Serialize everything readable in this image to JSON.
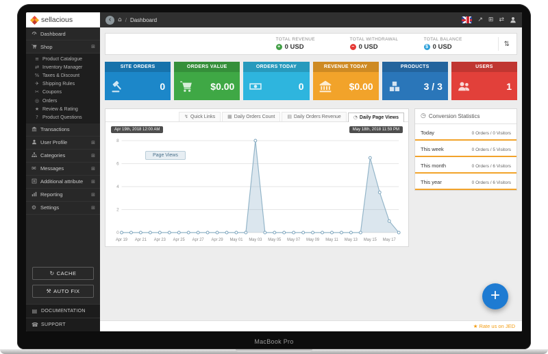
{
  "device": {
    "label": "MacBook Pro"
  },
  "sidebar": {
    "brand": "sellacious",
    "items": [
      {
        "label": "Dashboard",
        "icon": "dashboard",
        "expandable": false
      },
      {
        "label": "Shop",
        "icon": "shopping-cart",
        "expandable": true,
        "expanded": true,
        "children": [
          {
            "label": "Product Catalogue",
            "icon": "list"
          },
          {
            "label": "Inventory Manager",
            "icon": "exchange"
          },
          {
            "label": "Taxes & Discount",
            "icon": "percent"
          },
          {
            "label": "Shipping Rules",
            "icon": "plane"
          },
          {
            "label": "Coupons",
            "icon": "scissors"
          },
          {
            "label": "Orders",
            "icon": "orders"
          },
          {
            "label": "Review & Rating",
            "icon": "star"
          },
          {
            "label": "Product Questions",
            "icon": "question"
          }
        ]
      },
      {
        "label": "Transactions",
        "icon": "bank-building",
        "expandable": false
      },
      {
        "label": "User Profile",
        "icon": "user",
        "expandable": true
      },
      {
        "label": "Categories",
        "icon": "sitemap",
        "expandable": true
      },
      {
        "label": "Messages",
        "icon": "envelope",
        "expandable": true
      },
      {
        "label": "Additional attribute",
        "icon": "attribute",
        "expandable": true
      },
      {
        "label": "Reporting",
        "icon": "report",
        "expandable": true
      },
      {
        "label": "Settings",
        "icon": "gear",
        "expandable": true
      }
    ],
    "actions": [
      {
        "label": "CACHE",
        "icon": "refresh"
      },
      {
        "label": "AUTO FIX",
        "icon": "wrench"
      }
    ],
    "footer_items": [
      {
        "label": "DOCUMENTATION",
        "icon": "book"
      },
      {
        "label": "SUPPORT",
        "icon": "support"
      }
    ]
  },
  "topbar": {
    "breadcrumb": "Dashboard"
  },
  "totals": [
    {
      "label": "TOTAL REVENUE",
      "value": "0 USD",
      "icon": "plus-circle",
      "color": "#43a047"
    },
    {
      "label": "TOTAL WITHDRAWAL",
      "value": "0 USD",
      "icon": "minus-circle",
      "color": "#e53935"
    },
    {
      "label": "TOTAL BALANCE",
      "value": "0 USD",
      "icon": "balance-circle",
      "color": "#2b9fd8"
    }
  ],
  "tiles": [
    {
      "label": "SITE ORDERS",
      "value": "0",
      "icon": "gavel",
      "color": "#1c87c9"
    },
    {
      "label": "ORDERS VALUE",
      "value": "$0.00",
      "icon": "shopping-cart-big",
      "color": "#3fa845"
    },
    {
      "label": "ORDERS TODAY",
      "value": "0",
      "icon": "banknote",
      "color": "#2eb5de"
    },
    {
      "label": "REVENUE TODAY",
      "value": "$0.00",
      "icon": "bank-big",
      "color": "#f2a32a"
    },
    {
      "label": "PRODUCTS",
      "value": "3 / 3",
      "icon": "cubes",
      "color": "#2a76b9"
    },
    {
      "label": "USERS",
      "value": "1",
      "icon": "user-group",
      "color": "#e2403a"
    }
  ],
  "chart_panel": {
    "tabs": [
      {
        "label": "Quick Links",
        "icon": "quick-links",
        "active": false
      },
      {
        "label": "Daily Orders Count",
        "icon": "calendar",
        "active": false
      },
      {
        "label": "Daily Orders Revenue",
        "icon": "revenue",
        "active": false
      },
      {
        "label": "Daily Page Views",
        "icon": "eye",
        "active": true
      }
    ],
    "range_start": "Apr 19th, 2018 12:00 AM",
    "range_end": "May 18th, 2018 11:59 PM",
    "legend": "Page Views"
  },
  "chart_data": {
    "type": "area",
    "title": "Daily Page Views",
    "series_name": "Page Views",
    "x": [
      "Apr 19",
      "Apr 20",
      "Apr 21",
      "Apr 22",
      "Apr 23",
      "Apr 24",
      "Apr 25",
      "Apr 26",
      "Apr 27",
      "Apr 28",
      "Apr 29",
      "Apr 30",
      "May 01",
      "May 02",
      "May 03",
      "May 04",
      "May 05",
      "May 06",
      "May 07",
      "May 08",
      "May 09",
      "May 10",
      "May 11",
      "May 12",
      "May 13",
      "May 14",
      "May 15",
      "May 16",
      "May 17",
      "May 18"
    ],
    "values": [
      0,
      0,
      0,
      0,
      0,
      0,
      0,
      0,
      0,
      0,
      0,
      0,
      0,
      0,
      8,
      0,
      0,
      0,
      0,
      0,
      0,
      0,
      0,
      0,
      0,
      0,
      6.5,
      3.5,
      1,
      0
    ],
    "tick_labels": [
      "Apr 19",
      "Apr 21",
      "Apr 23",
      "Apr 25",
      "Apr 27",
      "Apr 29",
      "May 01",
      "May 03",
      "May 05",
      "May 07",
      "May 09",
      "May 11",
      "May 13",
      "May 15",
      "May 17"
    ],
    "yticks": [
      0,
      2,
      4,
      6,
      8
    ],
    "ylim": [
      0,
      8
    ],
    "grid": true,
    "legend_position": "top-left"
  },
  "conversion": {
    "title": "Conversion Statistics",
    "rows": [
      {
        "label": "Today",
        "value": "0 Orders / 0 Visitors"
      },
      {
        "label": "This week",
        "value": "0 Orders / 5 Visitors"
      },
      {
        "label": "This month",
        "value": "0 Orders / 6 Visitors"
      },
      {
        "label": "This year",
        "value": "0 Orders / 6 Visitors"
      }
    ]
  },
  "footer": {
    "rate_label": "Rate us on JED"
  }
}
